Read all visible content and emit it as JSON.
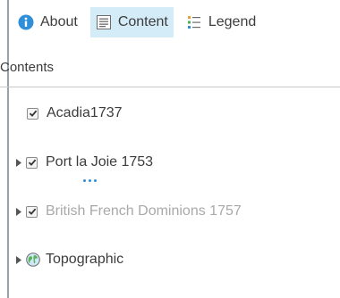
{
  "tabs": [
    {
      "label": "About",
      "icon": "info-icon"
    },
    {
      "label": "Content",
      "icon": "content-list-icon",
      "active": true
    },
    {
      "label": "Legend",
      "icon": "legend-icon"
    }
  ],
  "contents_header": "Contents",
  "layers": [
    {
      "label": "Acadia1737",
      "checked": true,
      "expandable": false
    },
    {
      "label": "Port la Joie 1753",
      "checked": true,
      "expandable": true
    },
    {
      "label": "British French Dominions 1757",
      "checked": true,
      "expandable": true,
      "dimmed": true
    },
    {
      "label": "Topographic",
      "checked": null,
      "expandable": true,
      "icon": "globe-icon"
    }
  ],
  "colors": {
    "accent": "#2f8fd8",
    "active_tab_bg": "#d4ebf8",
    "dimmed_text": "#a9a9a9"
  }
}
